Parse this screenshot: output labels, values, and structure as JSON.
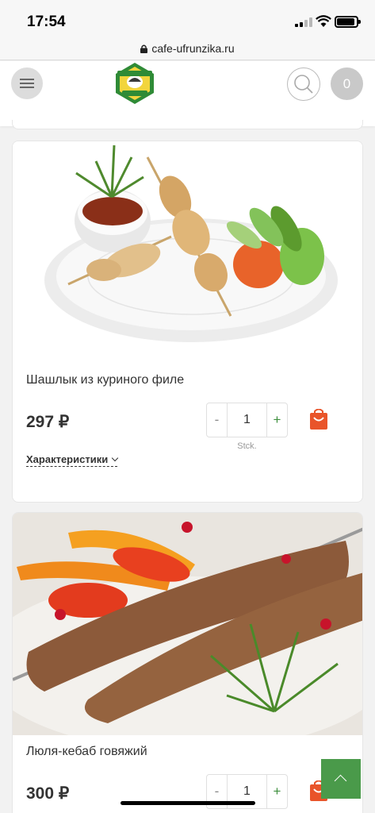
{
  "status_bar": {
    "time": "17:54",
    "battery_level": 0.9
  },
  "url_bar": {
    "domain": "cafe-ufrunzika.ru"
  },
  "header": {
    "cart_count": "0",
    "logo_icon": "cafe-logo",
    "menu_icon": "hamburger-icon",
    "search_icon": "search-icon"
  },
  "products": [
    {
      "title": "Шашлык из куриного филе",
      "price": "297 ₽",
      "quantity": "1",
      "unit": "Stck.",
      "minus": "-",
      "plus": "+",
      "specs_label": "Характеристики",
      "image_icon": "chicken-skewer-photo"
    },
    {
      "title": "Люля-кебаб говяжий",
      "price": "300 ₽",
      "quantity": "1",
      "minus": "-",
      "plus": "+",
      "image_icon": "lula-kebab-photo"
    }
  ],
  "colors": {
    "accent_green": "#4a9a4a",
    "cart_orange": "#e9542a"
  }
}
